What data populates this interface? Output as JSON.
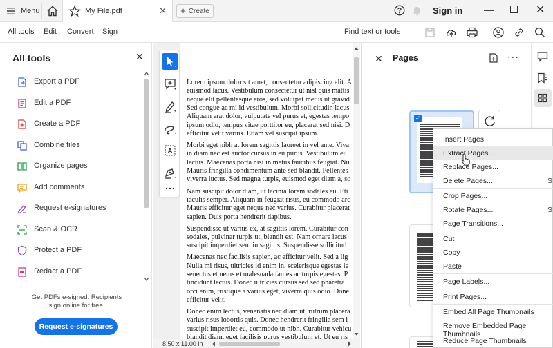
{
  "titlebar": {
    "menu_label": "Menu",
    "tab_title": "My File.pdf",
    "tab_close": "✕",
    "create_label": "Create",
    "signin_label": "Sign in",
    "minimize": "—",
    "close": "✕"
  },
  "toolbar": {
    "menu": [
      "All tools",
      "Edit",
      "Convert",
      "Sign"
    ],
    "find_label": "Find text or tools"
  },
  "left_panel": {
    "title": "All tools",
    "close": "✕",
    "items": [
      {
        "label": "Export a PDF",
        "icon": "export-pdf-icon",
        "color": "#3a6fd8"
      },
      {
        "label": "Edit a PDF",
        "icon": "edit-pdf-icon",
        "color": "#d5317a"
      },
      {
        "label": "Create a PDF",
        "icon": "create-pdf-icon",
        "color": "#e03a3a"
      },
      {
        "label": "Combine files",
        "icon": "combine-files-icon",
        "color": "#4a5ee0"
      },
      {
        "label": "Organize pages",
        "icon": "organize-pages-icon",
        "color": "#2e9d4a"
      },
      {
        "label": "Add comments",
        "icon": "add-comments-icon",
        "color": "#e8a21a"
      },
      {
        "label": "Request e-signatures",
        "icon": "request-esign-icon",
        "color": "#8c52d6"
      },
      {
        "label": "Scan & OCR",
        "icon": "scan-ocr-icon",
        "color": "#2e9d4a"
      },
      {
        "label": "Protect a PDF",
        "icon": "protect-pdf-icon",
        "color": "#8c52d6"
      },
      {
        "label": "Redact a PDF",
        "icon": "redact-pdf-icon",
        "color": "#d5317a"
      }
    ],
    "footer_text": "Get PDFs e-signed. Recipients sign online for free.",
    "footer_button": "Request e-signatures"
  },
  "document": {
    "paragraphs": [
      "Lorem ipsum dolor sit amet, consectetur adipiscing elit. A\neuismod lacus. Vestibulum consectetur ut nisl quis mattis\nneque elit pellentesque eros, sed volutpat metus ut gravid\nSed congue ac mi id vestibulum. Morbi sollicitudin lacus\nAliquam erat dolor, vulputate vel purus et, egestas tempo\nipsum odio, tempus vitae porttitor eu, placerat sed nisi. D\nefficitur velit varius. Etiam vel suscipit ipsum.",
      "Morbi eget nibh at lorem sagittis laoreet in vel ante. Viva\nin diam nec est auctor cursus in eu purus. Vestibulum eu\nlectus. Maecenas porta nisi in metus faucibus feugiat. Nu\nMauris fringilla condimentum ante sed blandit. Pellentes\nviverra luctus. Sed magna turpis, euismod eget diam a, so",
      "Nam suscipit dolor diam, ut lacinia lorem sodales eu. Eti\niaculis semper. Aliquam in feugiat risus, eu commodo arc\nMauris efficitur eget neque nec varius. Curabitur placerat\nsapien. Duis porta hendrerit dapibus.",
      "Suspendisse ut varius ex, at sagittis lorem. Curabitur con\nsodales, pulvinar turpis ut, blandit est. Nam ornare lacus\nsuscipit imperdiet sem in sagittis. Suspendisse sollicitud",
      "Maecenas nec facilisis sapien, ac efficitur velit. Sed a lig\nNulla mi risus, ultricies id enim in, scelerisque egestas le\nsenectus et netus et malesuada fames ac turpis egestas. P\ntincidunt lectus. Donec ultricies cursus sed sed pharetra.\norci enim, tristique a varius eget, viverra quis odio. Done\nefficitur velit.",
      "Donec enim lectus, venenatis nec diam ut, rutrum placera\nvarius risus lobortis quis. Donec hendrerit fringilla sem i\nsuscipit imperdiet eu, commodo ut nibh. Curabitur vehicu\nblandit diam, eget facilisis purus vestibulum et. Ut eu ris"
    ],
    "page_size": "8.50 x 11.00 in"
  },
  "pages_panel": {
    "title": "Pages",
    "close": "✕",
    "more": "···"
  },
  "context_menu": {
    "items": [
      {
        "label": "Insert Pages",
        "shortcut": ""
      },
      {
        "label": "Extract Pages...",
        "shortcut": ""
      },
      {
        "label": "Replace Pages...",
        "shortcut": ""
      },
      {
        "label": "Delete Pages...",
        "shortcut": "S"
      },
      {
        "label": "Crop Pages...",
        "shortcut": ""
      },
      {
        "label": "Rotate Pages...",
        "shortcut": "S"
      },
      {
        "label": "Page Transitions...",
        "shortcut": ""
      },
      {
        "label": "Cut",
        "shortcut": ""
      },
      {
        "label": "Copy",
        "shortcut": ""
      },
      {
        "label": "Paste",
        "shortcut": ""
      },
      {
        "label": "Page Labels...",
        "shortcut": ""
      },
      {
        "label": "Print Pages...",
        "shortcut": ""
      },
      {
        "label": "Embed All Page Thumbnails",
        "shortcut": ""
      },
      {
        "label": "Remove Embedded Page Thumbnails",
        "shortcut": ""
      },
      {
        "label": "Reduce Page Thumbnails",
        "shortcut": ""
      }
    ],
    "hovered": "Extract Pages..."
  },
  "colors": {
    "accent": "#1473e6",
    "selection": "#9cc6f4"
  }
}
